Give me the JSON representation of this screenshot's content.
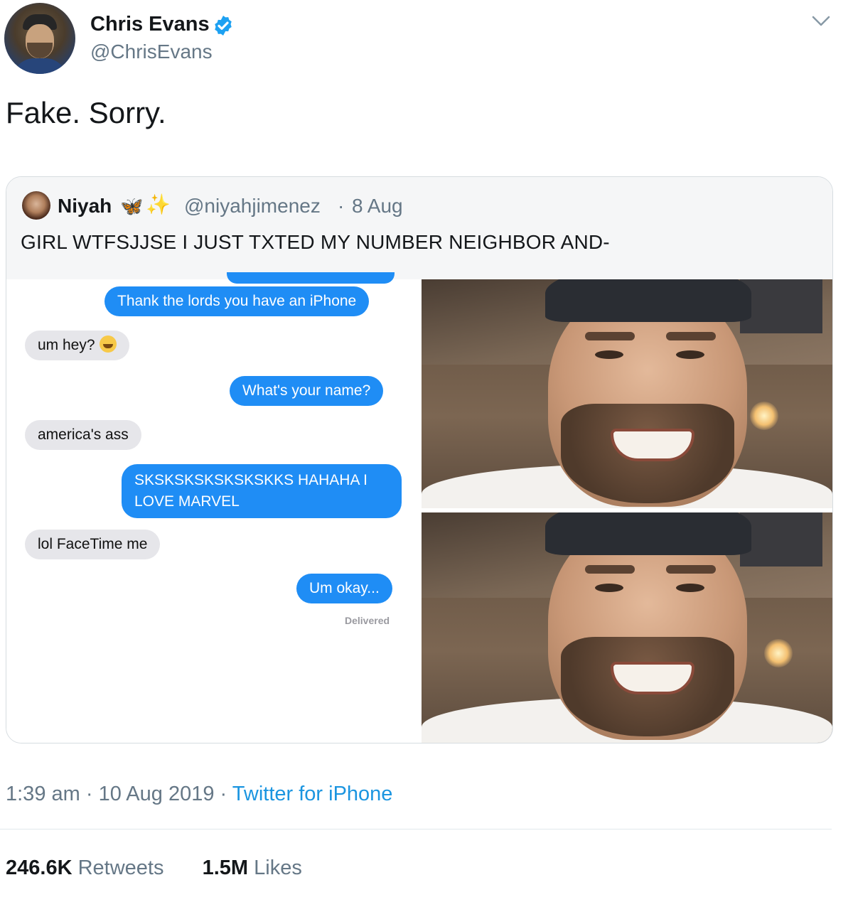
{
  "author": {
    "name": "Chris Evans",
    "handle": "@ChrisEvans",
    "verified": true,
    "avatar_icon": "profile-photo"
  },
  "tweet": {
    "text": "Fake. Sorry."
  },
  "quoted_tweet": {
    "name": "Niyah",
    "name_emoji_1": "🦋",
    "name_emoji_2": "✨",
    "handle": "@niyahjimenez",
    "separator": "·",
    "date": "8 Aug",
    "text": "GIRL WTFSJJSE I JUST TXTED MY NUMBER NEIGHBOR AND-",
    "messages": [
      {
        "dir": "out",
        "text": "Thank the lords you have an iPhone"
      },
      {
        "dir": "in",
        "text": "um hey?",
        "emoji": "grinning-sweat-face"
      },
      {
        "dir": "out",
        "text": "What's your name?"
      },
      {
        "dir": "in",
        "text": "america's ass"
      },
      {
        "dir": "out",
        "text": "SKSKSKSKSKSKSKKS HAHAHA I LOVE MARVEL"
      },
      {
        "dir": "in",
        "text": "lol FaceTime me"
      },
      {
        "dir": "out",
        "text": "Um okay..."
      }
    ],
    "delivered": "Delivered"
  },
  "meta": {
    "time": "1:39 am",
    "sep1": "·",
    "date": "10 Aug 2019",
    "sep2": "·",
    "source": "Twitter for iPhone"
  },
  "stats": {
    "retweets_count": "246.6K",
    "retweets_label": "Retweets",
    "likes_count": "1.5M",
    "likes_label": "Likes"
  },
  "colors": {
    "link_blue": "#1b95e0",
    "imessage_blue": "#1f8df5",
    "gray_bubble": "#e6e6ea",
    "muted_text": "#657786"
  }
}
